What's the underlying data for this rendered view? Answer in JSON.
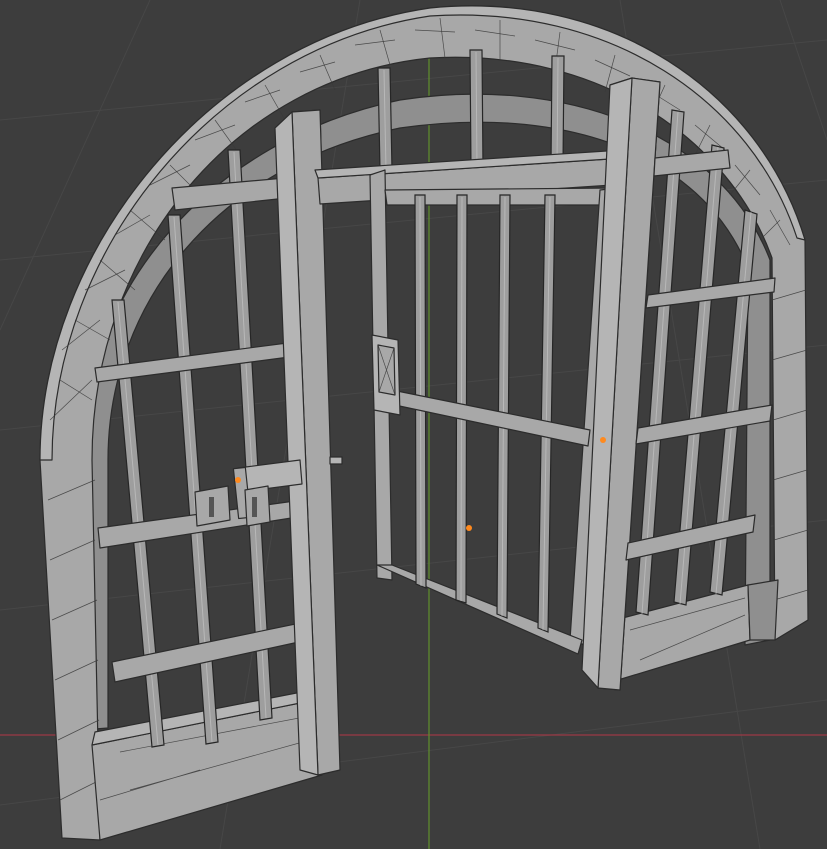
{
  "viewport": {
    "background": "#3d3d3d",
    "grid_color": "#474747",
    "x_axis_color": "#9c3a45",
    "y_axis_color": "#5e8a2e",
    "mesh_color": "#a8a8a8",
    "edge_color": "#2c2c2c",
    "origin_marker_color": "#ff8a1e"
  },
  "scene": {
    "object": "gate-icon",
    "shading": "solid-wireframe"
  }
}
